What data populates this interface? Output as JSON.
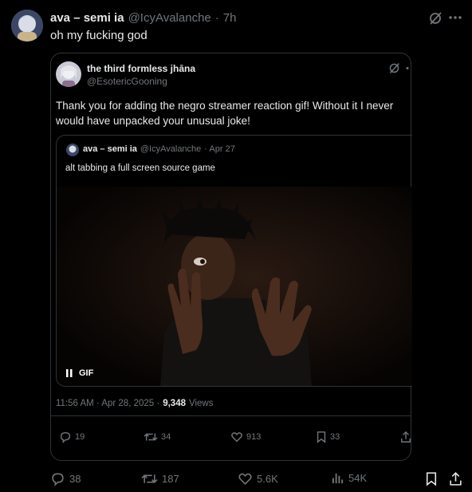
{
  "outer": {
    "author_name": "ava – semi ia",
    "author_handle": "@IcyAvalanche",
    "separator": "·",
    "time": "7h",
    "text": "oh my fucking god",
    "stats": {
      "replies": "38",
      "reposts": "187",
      "likes": "5.6K",
      "views": "54K"
    }
  },
  "quoted": {
    "author_name": "the third formless jhāna",
    "author_handle": "@EsotericGooning",
    "text": "Thank you for adding the negro streamer reaction gif! Without it I never would have unpacked your unusual joke!",
    "timestamp": "11:56 AM · Apr 28, 2025 ·",
    "views_count": "9,348",
    "views_label": "Views",
    "stats": {
      "replies": "19",
      "reposts": "34",
      "likes": "913",
      "bookmarks": "33"
    }
  },
  "nested": {
    "author_name": "ava – semi ia",
    "author_handle": "@IcyAvalanche",
    "date": "· Apr 27",
    "text": "alt tabbing a full screen source game",
    "media_label": "GIF"
  },
  "colors": {
    "background": "#000000",
    "text": "#e7e9ea",
    "muted": "#71767b",
    "border": "#2f3336"
  }
}
